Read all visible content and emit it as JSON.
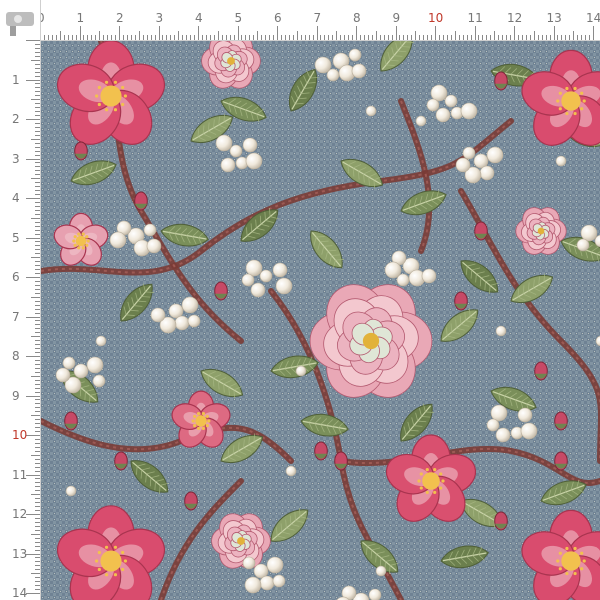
{
  "ruler": {
    "top_labels": [
      "0",
      "1",
      "2",
      "3",
      "4",
      "5",
      "6",
      "7",
      "8",
      "9",
      "10",
      "11",
      "12",
      "13",
      "14"
    ],
    "left_labels": [
      "1",
      "2",
      "3",
      "4",
      "5",
      "6",
      "7",
      "8",
      "9",
      "10",
      "11",
      "12",
      "13",
      "14"
    ],
    "emphasis_label": "10",
    "emphasis_color": "#c0392b"
  },
  "colors": {
    "fabric_base": "#6d8090",
    "flower_pink": "#d94c6e",
    "flower_light": "#f3c8cf",
    "leaf_green": "#7a8f5a",
    "stem_brown": "#7a3b35",
    "pearl": "#f4eee2"
  }
}
